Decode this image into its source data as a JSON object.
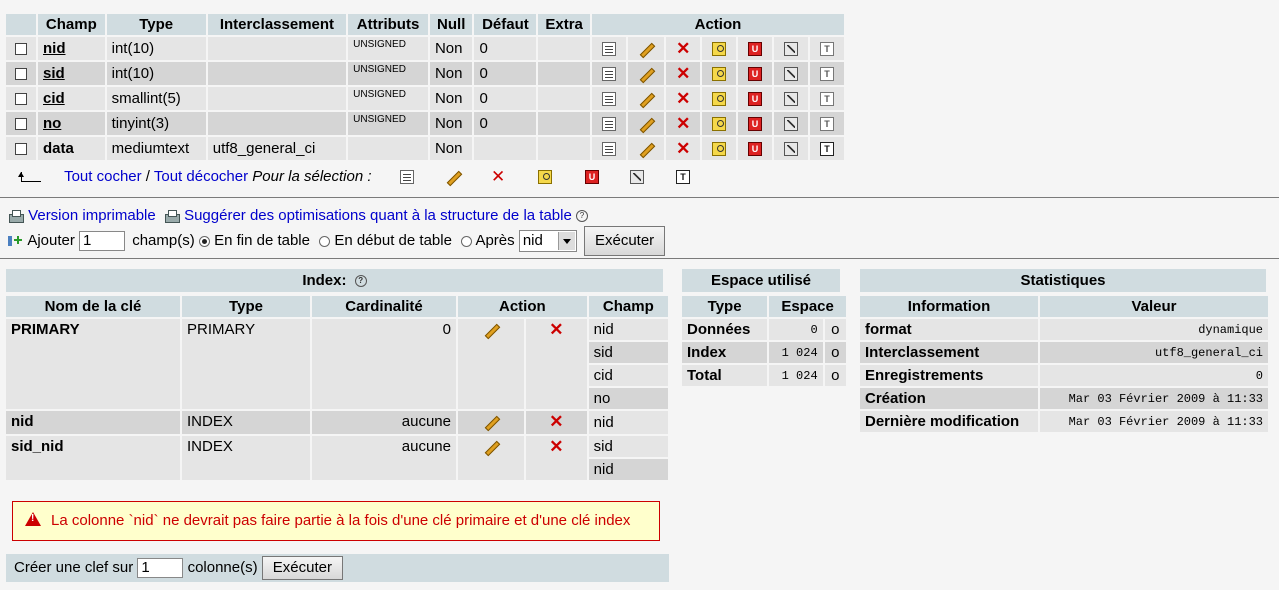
{
  "structure": {
    "headers": [
      "Champ",
      "Type",
      "Interclassement",
      "Attributs",
      "Null",
      "Défaut",
      "Extra",
      "Action"
    ],
    "rows": [
      {
        "name": "nid",
        "type": "int(10)",
        "collation": "",
        "attributes": "UNSIGNED",
        "null": "Non",
        "default": "0",
        "extra": "",
        "primary": true
      },
      {
        "name": "sid",
        "type": "int(10)",
        "collation": "",
        "attributes": "UNSIGNED",
        "null": "Non",
        "default": "0",
        "extra": "",
        "primary": true
      },
      {
        "name": "cid",
        "type": "smallint(5)",
        "collation": "",
        "attributes": "UNSIGNED",
        "null": "Non",
        "default": "0",
        "extra": "",
        "primary": true
      },
      {
        "name": "no",
        "type": "tinyint(3)",
        "collation": "",
        "attributes": "UNSIGNED",
        "null": "Non",
        "default": "0",
        "extra": "",
        "primary": true
      },
      {
        "name": "data",
        "type": "mediumtext",
        "collation": "utf8_general_ci",
        "attributes": "",
        "null": "Non",
        "default": "",
        "extra": "",
        "primary": false
      }
    ],
    "check_all": "Tout cocher",
    "separator": "/",
    "uncheck_all": "Tout décocher",
    "for_selection": "Pour la sélection :"
  },
  "links": {
    "printable": "Version imprimable",
    "suggest": "Suggérer des optimisations quant à la structure de la table"
  },
  "add_fields": {
    "label": "Ajouter",
    "value": "1",
    "unit": "champ(s)",
    "end_label": "En fin de table",
    "start_label": "En début de table",
    "after_label": "Après",
    "after_value": "nid",
    "selected": "end",
    "submit": "Exécuter"
  },
  "indexes": {
    "title": "Index:",
    "headers": [
      "Nom de la clé",
      "Type",
      "Cardinalité",
      "Action",
      "Champ"
    ],
    "rows": [
      {
        "name": "PRIMARY",
        "type": "PRIMARY",
        "cardinality": "0",
        "fields": [
          "nid",
          "sid",
          "cid",
          "no"
        ]
      },
      {
        "name": "nid",
        "type": "INDEX",
        "cardinality": "aucune",
        "fields": [
          "nid"
        ]
      },
      {
        "name": "sid_nid",
        "type": "INDEX",
        "cardinality": "aucune",
        "fields": [
          "sid",
          "nid"
        ]
      }
    ],
    "warning": "La colonne `nid` ne devrait pas faire partie à la fois d'une clé primaire et d'une clé index",
    "create_label": "Créer une clef sur",
    "create_value": "1",
    "create_unit": "colonne(s)",
    "create_submit": "Exécuter"
  },
  "space": {
    "title": "Espace utilisé",
    "headers": [
      "Type",
      "Espace"
    ],
    "rows": [
      {
        "label": "Données",
        "value": "0",
        "unit": "o"
      },
      {
        "label": "Index",
        "value": "1 024",
        "unit": "o"
      },
      {
        "label": "Total",
        "value": "1 024",
        "unit": "o"
      }
    ]
  },
  "stats": {
    "title": "Statistiques",
    "headers": [
      "Information",
      "Valeur"
    ],
    "rows": [
      {
        "label": "format",
        "value": "dynamique"
      },
      {
        "label": "Interclassement",
        "value": "utf8_general_ci"
      },
      {
        "label": "Enregistrements",
        "value": "0"
      },
      {
        "label": "Création",
        "value": "Mar 03 Février 2009 à 11:33"
      },
      {
        "label": "Dernière modification",
        "value": "Mar 03 Février 2009 à 11:33"
      }
    ]
  },
  "icons": [
    "browse-icon",
    "edit-icon",
    "delete-icon",
    "primary-key-icon",
    "unique-icon",
    "index-icon",
    "fulltext-icon",
    "print-icon",
    "help-icon",
    "warning-icon",
    "arrow-up-left-icon",
    "add-column-icon"
  ]
}
